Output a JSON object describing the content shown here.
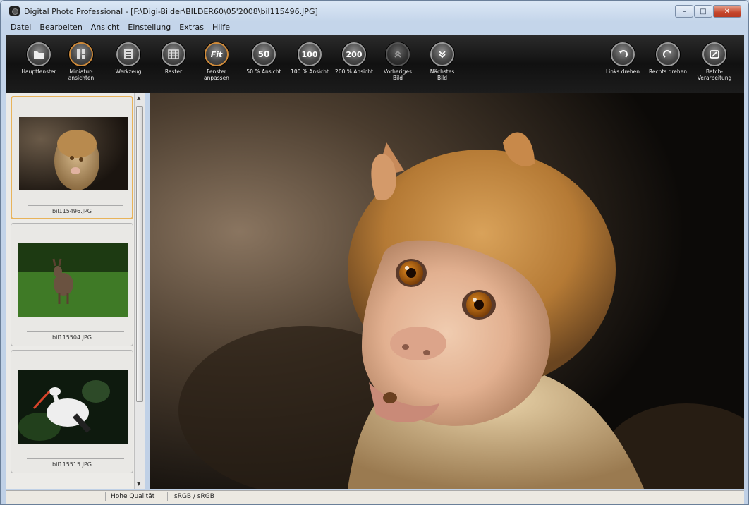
{
  "window": {
    "title": "Digital Photo Professional - [F:\\Digi-Bilder\\BILDER60\\05'2008\\bil115496.JPG]",
    "controls": {
      "minimize": "–",
      "maximize": "□",
      "close": "✕"
    }
  },
  "menu": [
    "Datei",
    "Bearbeiten",
    "Ansicht",
    "Einstellung",
    "Extras",
    "Hilfe"
  ],
  "toolbar": {
    "hauptfenster": "Hauptfenster",
    "miniatur": "Miniatur-\nansichten",
    "werkzeug": "Werkzeug",
    "raster": "Raster",
    "fenster": "Fenster\nanpassen",
    "fit_glyph": "Fit",
    "view50": "50 % Ansicht",
    "view50_glyph": "50",
    "view100": "100 % Ansicht",
    "view100_glyph": "100",
    "view200": "200 % Ansicht",
    "view200_glyph": "200",
    "prev": "Vorheriges\nBild",
    "next": "Nächstes\nBild",
    "rotate_left": "Links drehen",
    "rotate_right": "Rechts drehen",
    "batch": "Batch-\nVerarbeitung"
  },
  "thumbnails": [
    {
      "name": "bil115496.JPG",
      "selected": true
    },
    {
      "name": "bil115504.JPG",
      "selected": false
    },
    {
      "name": "bil115515.JPG",
      "selected": false
    }
  ],
  "status": {
    "quality": "Hohe Qualität",
    "color_space": "sRGB / sRGB"
  },
  "colors": {
    "toolbar_bg": "#1a1a1a",
    "selected_border": "#e8b35a",
    "panel_bg": "#ecebe8"
  }
}
